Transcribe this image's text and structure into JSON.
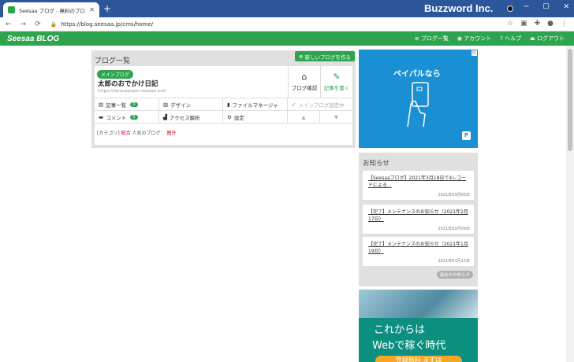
{
  "browser": {
    "tab_title": "Seesaa ブログ - 無料のブログ(blog)",
    "url": "https://blog.seesaa.jp/cms/home/",
    "watermark": "Buzzword Inc."
  },
  "header": {
    "logo": "Seesaa BLOG",
    "nav": [
      {
        "label": "ブログ一覧",
        "icon": "list-icon"
      },
      {
        "label": "アカウント",
        "icon": "user-icon"
      },
      {
        "label": "ヘルプ",
        "icon": "help-icon"
      },
      {
        "label": "ログアウト",
        "icon": "logout-icon"
      }
    ]
  },
  "blog_list": {
    "title": "ブログ一覧",
    "new_blog_label": "新しいブログを作る",
    "blog": {
      "badge": "メインブログ",
      "name": "太郎のおでかけ日記",
      "url": "https://tarouapaper.seesaa.net/",
      "confirm_label": "ブログ確認",
      "write_label": "記事を書く"
    },
    "rows": [
      [
        "記事一覧",
        "デザイン",
        "ファイルマネージャ",
        "メインブログ設定中"
      ],
      [
        "コメント",
        "アクセス解析",
        "設定"
      ]
    ],
    "article_count": "0",
    "comment_count": "0",
    "category_prefix": "[カテゴリ]",
    "category_value": "総合",
    "popular_prefix": "人気のブログ：",
    "popular_value": "圏外"
  },
  "ads": {
    "ad1_text": "ペイパルなら",
    "ad2_line1": "これからは",
    "ad2_line2": "Webで稼ぐ時代",
    "ad2_cta": "登録無料 まずは"
  },
  "news": {
    "title": "お知らせ",
    "items": [
      {
        "text": "【Seesaaブログ】2021年3月18日で4レコードによる...",
        "date": "2021年03月05日"
      },
      {
        "text": "【完了】メンテナンスのお知らせ（2021年2月17日）",
        "date": "2021年02月09日"
      },
      {
        "text": "【完了】メンテナンスのお知らせ（2021年1月19日）",
        "date": "2021年01月12日"
      }
    ],
    "past_label": "過去のお知らせ"
  }
}
